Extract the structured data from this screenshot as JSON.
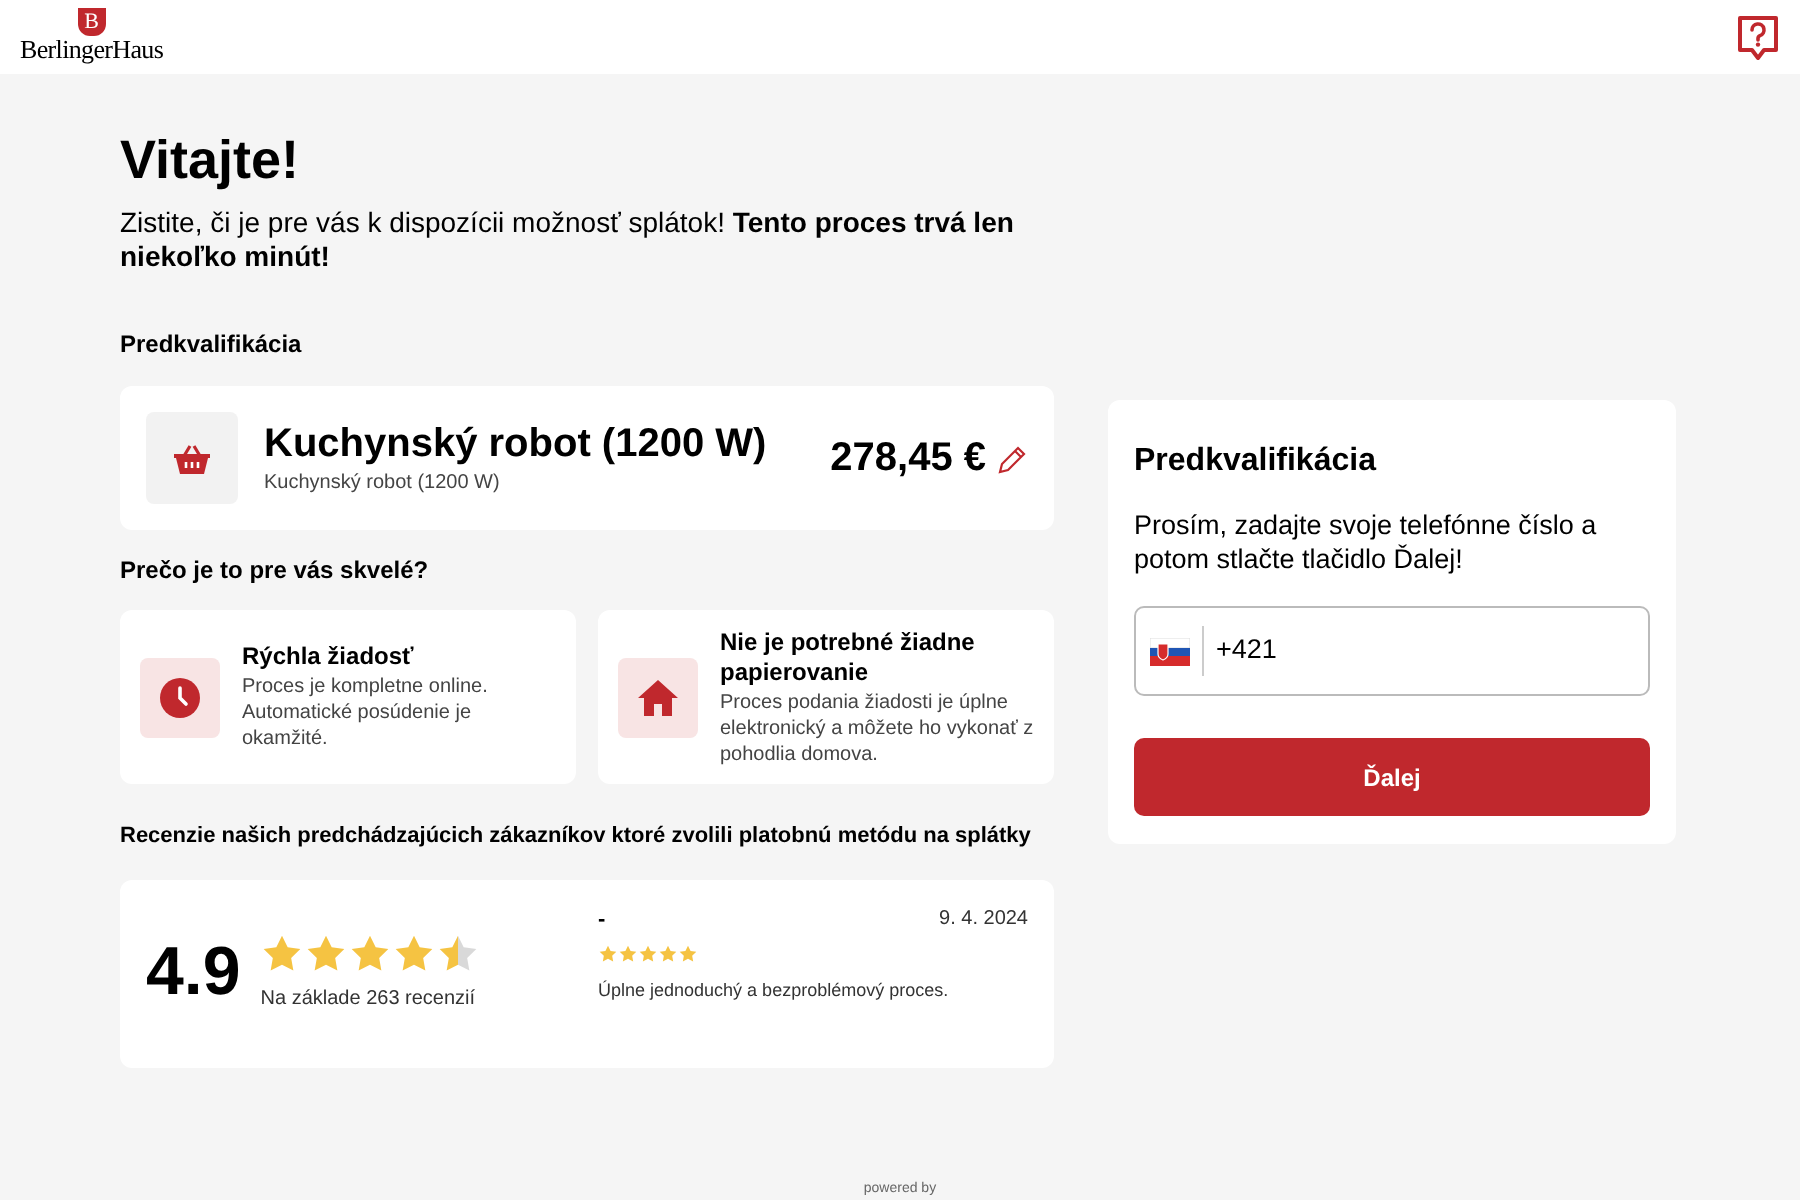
{
  "header": {
    "logo": {
      "letter": "B",
      "name": "BerlingerHaus"
    }
  },
  "welcome": {
    "title": "Vitajte!",
    "intro": "Zistite, či je pre vás k dispozícii možnosť splátok! **Tento proces trvá len niekoľko minút!**"
  },
  "product_section": {
    "title": "Predkvalifikácia",
    "name": "Kuchynský robot (1200 W)",
    "subtitle": "Kuchynský robot (1200 W)",
    "price": "278,45 €"
  },
  "benefits": {
    "title": "Prečo je to pre vás skvelé?",
    "items": [
      {
        "kind": "clock",
        "title": "Rýchla žiadosť",
        "text": "Proces je kompletne online. Automatické posúdenie je okamžité."
      },
      {
        "kind": "home",
        "title": "Nie je potrebné žiadne papierovanie",
        "text": "Proces podania žiadosti je úplne elektronický a môžete ho vykonať z pohodlia domova."
      }
    ]
  },
  "reviews": {
    "title": "Recenzie našich predchádzajúcich zákazníkov ktoré zvolili platobnú metódu na splátky",
    "score": "4.9",
    "stars": 4.5,
    "count_text": "Na základe 263 recenzií",
    "items": [
      {
        "author": "-",
        "date": "9. 4. 2024",
        "stars": 5,
        "text": "Úplne jednoduchý a bezproblémový proces."
      }
    ]
  },
  "form": {
    "title": "Predkvalifikácia",
    "instructions": "Prosím, zadajte svoje telefónne číslo a potom stlačte tlačidlo Ďalej!",
    "phone_value": "+421",
    "button": "Ďalej"
  },
  "footer": {
    "powered": "powered by"
  }
}
